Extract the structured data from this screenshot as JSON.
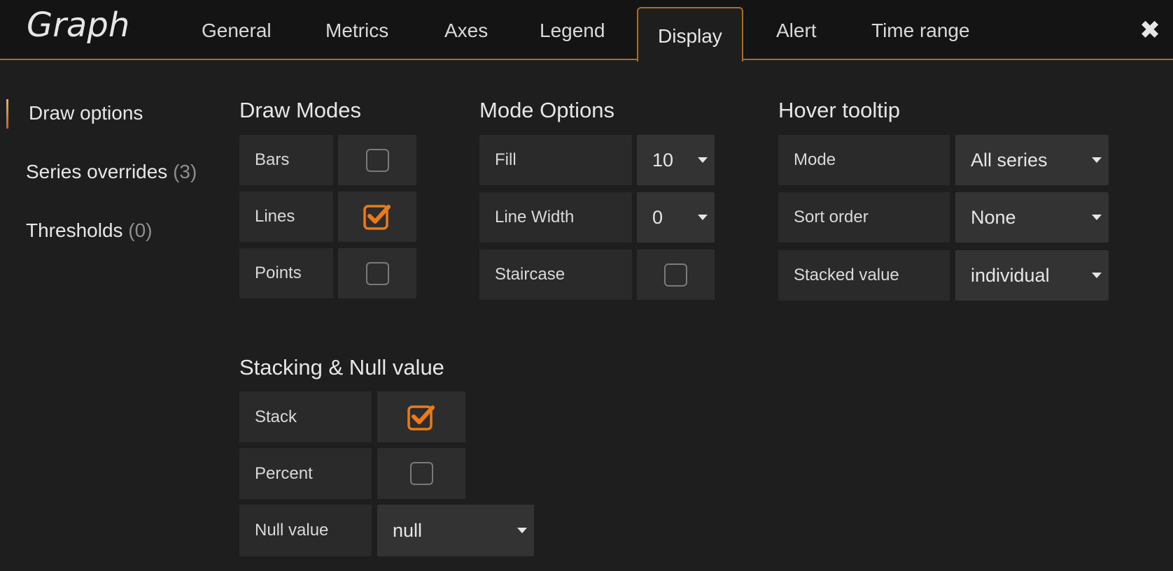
{
  "header": {
    "title": "Graph",
    "tabs": [
      {
        "label": "General"
      },
      {
        "label": "Metrics"
      },
      {
        "label": "Axes"
      },
      {
        "label": "Legend"
      },
      {
        "label": "Display",
        "active": true
      },
      {
        "label": "Alert"
      },
      {
        "label": "Time range"
      }
    ],
    "close_icon": "close-icon"
  },
  "sidenav": {
    "items": [
      {
        "label": "Draw options",
        "count": "",
        "active": true
      },
      {
        "label": "Series overrides",
        "count": "(3)"
      },
      {
        "label": "Thresholds",
        "count": "(0)"
      }
    ]
  },
  "draw_modes": {
    "title": "Draw Modes",
    "rows": [
      {
        "label": "Bars",
        "checked": false
      },
      {
        "label": "Lines",
        "checked": true
      },
      {
        "label": "Points",
        "checked": false
      }
    ]
  },
  "mode_options": {
    "title": "Mode Options",
    "fill": {
      "label": "Fill",
      "value": "10"
    },
    "line_width": {
      "label": "Line Width",
      "value": "0"
    },
    "staircase": {
      "label": "Staircase",
      "checked": false
    }
  },
  "hover_tooltip": {
    "title": "Hover tooltip",
    "mode": {
      "label": "Mode",
      "value": "All series"
    },
    "sort_order": {
      "label": "Sort order",
      "value": "None"
    },
    "stacked_value": {
      "label": "Stacked value",
      "value": "individual"
    }
  },
  "stacking": {
    "title": "Stacking & Null value",
    "stack": {
      "label": "Stack",
      "checked": true
    },
    "percent": {
      "label": "Percent",
      "checked": false
    },
    "null_value": {
      "label": "Null value",
      "value": "null"
    }
  },
  "colors": {
    "accent": "#eb7b18",
    "background": "#1f1e1f",
    "topbar": "#141414"
  }
}
